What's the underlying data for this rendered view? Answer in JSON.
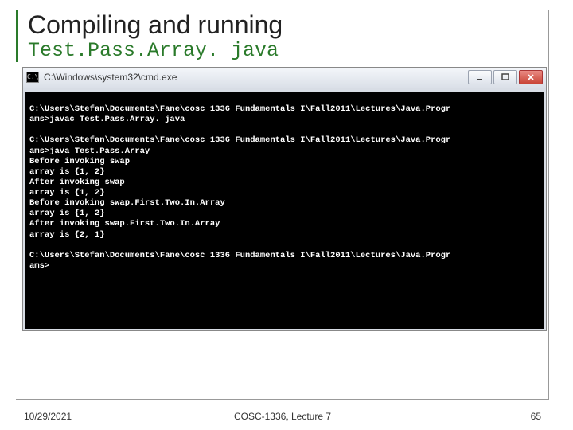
{
  "title": "Compiling and running",
  "subtitle": "Test.Pass.Array. java",
  "cmd": {
    "window_title": "C:\\Windows\\system32\\cmd.exe",
    "icon_label": "cmd-icon",
    "lines": [
      "",
      "C:\\Users\\Stefan\\Documents\\Fane\\cosc 1336 Fundamentals I\\Fall2011\\Lectures\\Java.Progr",
      "ams>javac Test.Pass.Array. java",
      "",
      "C:\\Users\\Stefan\\Documents\\Fane\\cosc 1336 Fundamentals I\\Fall2011\\Lectures\\Java.Progr",
      "ams>java Test.Pass.Array",
      "Before invoking swap",
      "array is {1, 2}",
      "After invoking swap",
      "array is {1, 2}",
      "Before invoking swap.First.Two.In.Array",
      "array is {1, 2}",
      "After invoking swap.First.Two.In.Array",
      "array is {2, 1}",
      "",
      "C:\\Users\\Stefan\\Documents\\Fane\\cosc 1336 Fundamentals I\\Fall2011\\Lectures\\Java.Progr",
      "ams>"
    ]
  },
  "footer": {
    "date": "10/29/2021",
    "center": "COSC-1336, Lecture 7",
    "page": "65"
  }
}
